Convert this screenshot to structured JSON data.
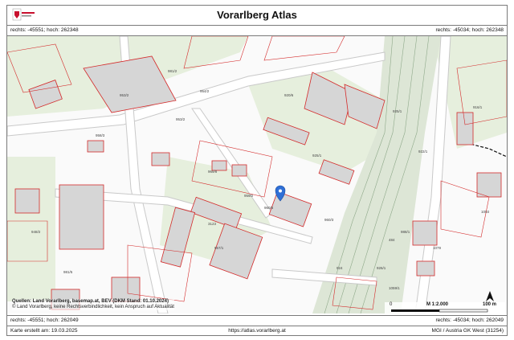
{
  "header": {
    "title": "Vorarlberg Atlas",
    "logo_icon": "vorarlberg-coat-of-arms-icon"
  },
  "coords_top": {
    "left": "rechts: -45551; hoch: 262348",
    "right": "rechts: -45034; hoch: 262348"
  },
  "coords_bottom": {
    "left": "rechts: -45551; hoch: 262049",
    "right": "rechts: -45034; hoch: 262049"
  },
  "map": {
    "colors": {
      "parcel_outline": "#d42a2a",
      "building_fill": "#d9d9d9",
      "green_area": "#e8f0e0",
      "road": "#ffffff",
      "railway": "#b8c7b0"
    },
    "marker_icon": "location-pin-icon",
    "parcel_labels": [
      "981/2",
      "953/2",
      "954/2",
      "958/3",
      "953/2",
      "969/8",
      "920/6",
      "925/1",
      "922/1",
      "959/2",
      "960/6",
      "960/3",
      "967/1",
      "924",
      "926/1",
      "988/1",
      "1059/1",
      "3123",
      "1079",
      "484",
      "925/1",
      "948/2",
      "916/1",
      "1003",
      "981/5"
    ],
    "source_lines": {
      "line1": "Quellen: Land Vorarlberg, basemap.at, BEV (DKM Stand: 01.10.2024)",
      "line2": "© Land Vorarlberg, keine Rechtsverbindlichkeit, kein Anspruch auf Aktualität"
    },
    "scale": {
      "start": "0",
      "ratio": "M 1:2.000",
      "end": "100 m"
    },
    "north_icon": "north-arrow-icon"
  },
  "footer": {
    "created": "Karte erstellt am: 19.03.2025",
    "url": "https://atlas.vorarlberg.at",
    "crs": "MGI / Austria GK West (31254)"
  }
}
